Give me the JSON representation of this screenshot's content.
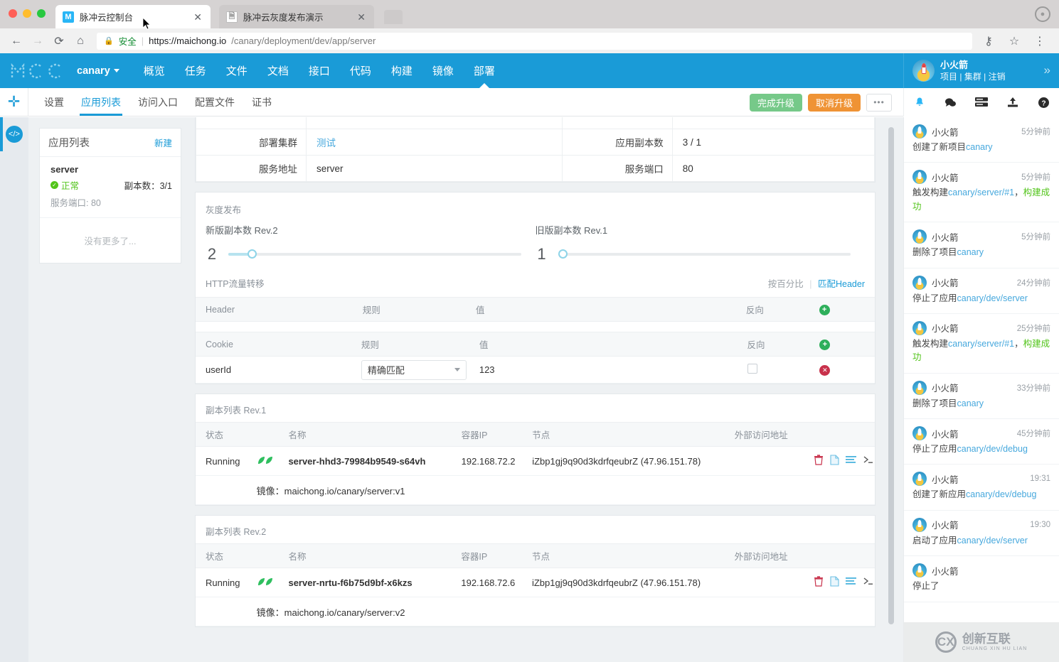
{
  "browser": {
    "tabs": [
      {
        "title": "脉冲云控制台",
        "favicon": "mcc-favicon",
        "active": true
      },
      {
        "title": "脉冲云灰度发布演示",
        "favicon": "document-icon",
        "active": false
      }
    ],
    "secure_label": "安全",
    "url_domain": "https://maichong.io",
    "url_path": "/canary/deployment/dev/app/server",
    "back_icon": "back-arrow-icon",
    "forward_icon": "forward-arrow-icon",
    "reload_icon": "reload-icon",
    "home_icon": "home-icon",
    "key_icon": "key-icon",
    "star_icon": "star-icon",
    "menu_icon": "kebab-menu-icon",
    "profile_icon": "browser-profile-icon"
  },
  "appbar": {
    "logo": "MCC",
    "project": "canary",
    "nav": [
      {
        "label": "概览",
        "active": false
      },
      {
        "label": "任务",
        "active": false
      },
      {
        "label": "文件",
        "active": false
      },
      {
        "label": "文档",
        "active": false
      },
      {
        "label": "接口",
        "active": false
      },
      {
        "label": "代码",
        "active": false
      },
      {
        "label": "构建",
        "active": false
      },
      {
        "label": "镜像",
        "active": false
      },
      {
        "label": "部署",
        "active": true
      }
    ],
    "user": {
      "name": "小火箭",
      "links": [
        "项目",
        "集群",
        "注销"
      ],
      "avatar": "rocket-avatar",
      "collapse_icon": "chevron-right-double-icon"
    }
  },
  "subbar": {
    "add_icon": "plus-icon",
    "tabs": [
      {
        "label": "设置",
        "active": false
      },
      {
        "label": "应用列表",
        "active": true
      },
      {
        "label": "访问入口",
        "active": false
      },
      {
        "label": "配置文件",
        "active": false
      },
      {
        "label": "证书",
        "active": false
      }
    ],
    "finish_upgrade": "完成升级",
    "cancel_upgrade": "取消升级",
    "more_label": "•••",
    "icons": [
      "bell-icon",
      "chat-icon",
      "log-icon",
      "upload-icon",
      "help-icon"
    ]
  },
  "colors": {
    "brand": "#1a9bd7",
    "success": "#52c41a",
    "green_button": "#76c989",
    "orange_button": "#ef9335",
    "link": "#46a8dd",
    "danger": "#c8314b"
  },
  "rail": {
    "code_icon": "code-brackets-icon"
  },
  "sidebar": {
    "title": "应用列表",
    "new_label": "新建",
    "apps": [
      {
        "name": "server",
        "status": "正常",
        "status_icon": "check-circle-icon",
        "replicas_label": "副本数：",
        "replicas_value": "3/1",
        "port_label": "服务端口: 80"
      }
    ],
    "no_more": "没有更多了..."
  },
  "main": {
    "info_rows": [
      {
        "label": "部署集群",
        "value": "测试",
        "is_link": true,
        "label2": "应用副本数",
        "value2": "3 / 1"
      },
      {
        "label": "服务地址",
        "value": "server",
        "is_link": false,
        "label2": "服务端口",
        "value2": "80"
      }
    ],
    "canary": {
      "title": "灰度发布",
      "new_version": {
        "label": "新版副本数 Rev.2",
        "value": "2",
        "percent": 8
      },
      "old_version": {
        "label": "旧版副本数 Rev.1",
        "value": "1",
        "percent": 0
      }
    },
    "http": {
      "label": "HTTP流量转移",
      "mode_percent": "按百分比",
      "mode_header": "匹配Header",
      "separator": "|"
    },
    "header_table": {
      "columns": [
        "Header",
        "规则",
        "值",
        "反向",
        ""
      ],
      "add_icon": "plus-circle-icon",
      "rows": []
    },
    "cookie_table": {
      "columns": [
        "Cookie",
        "规则",
        "值",
        "反向",
        ""
      ],
      "add_icon": "plus-circle-icon",
      "rows": [
        {
          "name": "userId",
          "rule": "精确匹配",
          "value": "123",
          "reverse": false,
          "delete_icon": "x-circle-icon"
        }
      ]
    },
    "replica_sections": [
      {
        "title": "副本列表 Rev.1",
        "columns": [
          "状态",
          "",
          "名称",
          "容器IP",
          "节点",
          "外部访问地址",
          ""
        ],
        "rows": [
          {
            "status": "Running",
            "health_icon": "leaf-pair-icon",
            "name": "server-hhd3-79984b9549-s64vh",
            "container_ip": "192.168.72.2",
            "node": "iZbp1gj9q90d3kdrfqeubrZ (47.96.151.78)",
            "external": "",
            "actions": [
              "trash-icon",
              "file-icon",
              "list-icon",
              "terminal-icon"
            ],
            "image_label": "镜像：maichong.io/canary/server:v1"
          }
        ]
      },
      {
        "title": "副本列表 Rev.2",
        "columns": [
          "状态",
          "",
          "名称",
          "容器IP",
          "节点",
          "外部访问地址",
          ""
        ],
        "rows": [
          {
            "status": "Running",
            "health_icon": "leaf-pair-icon",
            "name": "server-nrtu-f6b75d9bf-x6kzs",
            "container_ip": "192.168.72.6",
            "node": "iZbp1gj9q90d3kdrfqeubrZ (47.96.151.78)",
            "external": "",
            "actions": [
              "trash-icon",
              "file-icon",
              "list-icon",
              "terminal-icon"
            ],
            "image_label": "镜像：maichong.io/canary/server:v2"
          }
        ]
      }
    ]
  },
  "feed": {
    "items": [
      {
        "user": "小火箭",
        "time": "5分钟前",
        "prefix": "创建了新项目",
        "link": "canary",
        "suffix": "",
        "status": ""
      },
      {
        "user": "小火箭",
        "time": "5分钟前",
        "prefix": "触发构建",
        "link": "canary/server/#1",
        "suffix": "，",
        "status": "构建成功"
      },
      {
        "user": "小火箭",
        "time": "5分钟前",
        "prefix": "删除了项目",
        "link": "canary",
        "suffix": "",
        "status": ""
      },
      {
        "user": "小火箭",
        "time": "24分钟前",
        "prefix": "停止了应用",
        "link": "canary/dev/server",
        "suffix": "",
        "status": ""
      },
      {
        "user": "小火箭",
        "time": "25分钟前",
        "prefix": "触发构建",
        "link": "canary/server/#1",
        "suffix": "，",
        "status": "构建成功"
      },
      {
        "user": "小火箭",
        "time": "33分钟前",
        "prefix": "删除了项目",
        "link": "canary",
        "suffix": "",
        "status": ""
      },
      {
        "user": "小火箭",
        "time": "45分钟前",
        "prefix": "停止了应用",
        "link": "canary/dev/debug",
        "suffix": "",
        "status": ""
      },
      {
        "user": "小火箭",
        "time": "19:31",
        "prefix": "创建了新应用",
        "link": "canary/dev/debug",
        "suffix": "",
        "status": ""
      },
      {
        "user": "小火箭",
        "time": "19:30",
        "prefix": "启动了应用",
        "link": "canary/dev/server",
        "suffix": "",
        "status": ""
      },
      {
        "user": "小火箭",
        "time": "",
        "prefix": "停止了",
        "link": "",
        "suffix": "",
        "status": ""
      }
    ]
  },
  "watermark": {
    "cn": "创新互联",
    "en": "CHUANG XIN HU LIAN",
    "mark": "CX"
  }
}
